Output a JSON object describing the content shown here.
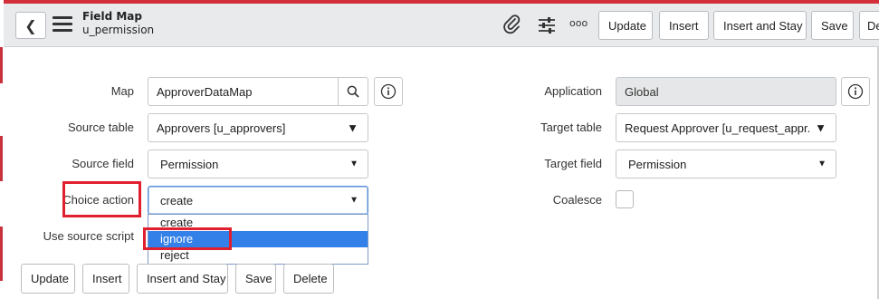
{
  "header": {
    "back_glyph": "❮",
    "title": "Field Map",
    "subtitle": "u_permission",
    "more_glyph": "ooo",
    "buttons": [
      "Update",
      "Insert",
      "Insert and Stay",
      "Save",
      "De"
    ]
  },
  "form": {
    "map": {
      "label": "Map",
      "value": "ApproverDataMap"
    },
    "source_table": {
      "label": "Source table",
      "value": "Approvers [u_approvers]"
    },
    "source_field": {
      "label": "Source field",
      "value": "Permission"
    },
    "choice_action": {
      "label": "Choice action",
      "value": "create",
      "options": [
        "create",
        "ignore",
        "reject"
      ],
      "highlighted_option": "ignore"
    },
    "use_source_script": {
      "label": "Use source script"
    },
    "application": {
      "label": "Application",
      "value": "Global"
    },
    "target_table": {
      "label": "Target table",
      "value": "Request Approver [u_request_appr..."
    },
    "target_field": {
      "label": "Target field",
      "value": "Permission"
    },
    "coalesce": {
      "label": "Coalesce",
      "checked": false
    }
  },
  "footer": {
    "buttons": [
      "Update",
      "Insert",
      "Insert and Stay",
      "Save",
      "Delete"
    ]
  },
  "colors": {
    "highlight": "#e0202f",
    "selected_option": "#3380e8",
    "header_bg": "#e9eaec",
    "readonly_bg": "#e6e7e8"
  },
  "icons": [
    "chevron-left-icon",
    "hamburger-menu-icon",
    "paperclip-icon",
    "settings-sliders-icon",
    "more-options-icon",
    "search-icon",
    "info-icon"
  ]
}
